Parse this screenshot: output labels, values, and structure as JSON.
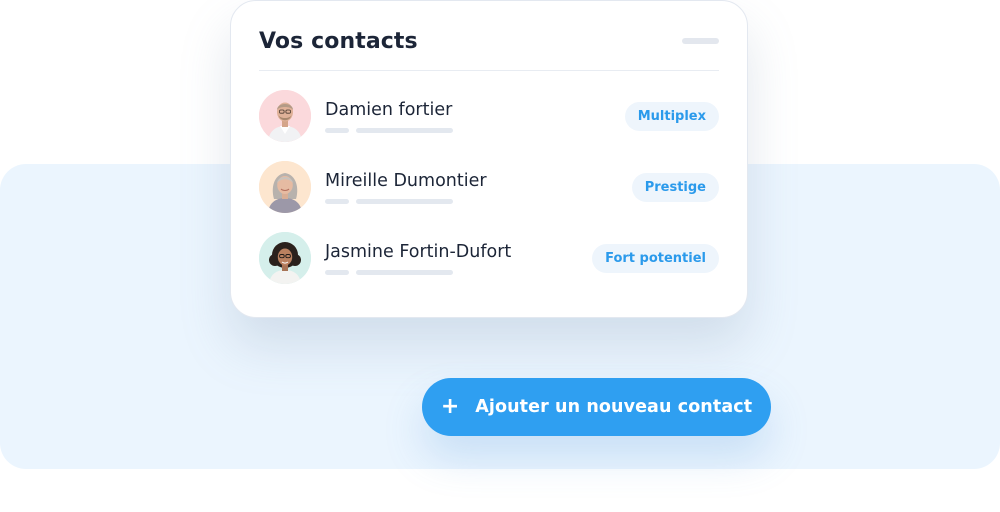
{
  "card": {
    "title": "Vos contacts"
  },
  "contacts": [
    {
      "name": "Damien fortier",
      "tag": "Multiplex",
      "avatar_bg": "#fbd9dc"
    },
    {
      "name": "Mireille Dumontier",
      "tag": "Prestige",
      "avatar_bg": "#fde6cf"
    },
    {
      "name": "Jasmine Fortin-Dufort",
      "tag": "Fort potentiel",
      "avatar_bg": "#d5efeb"
    }
  ],
  "add_button": {
    "icon": "plus-icon",
    "label": "Ajouter un nouveau contact"
  },
  "colors": {
    "accent": "#2f9ff1",
    "tag_text": "#2b9aeb",
    "backdrop": "#ebf5fe",
    "title_text": "#1c2537"
  }
}
